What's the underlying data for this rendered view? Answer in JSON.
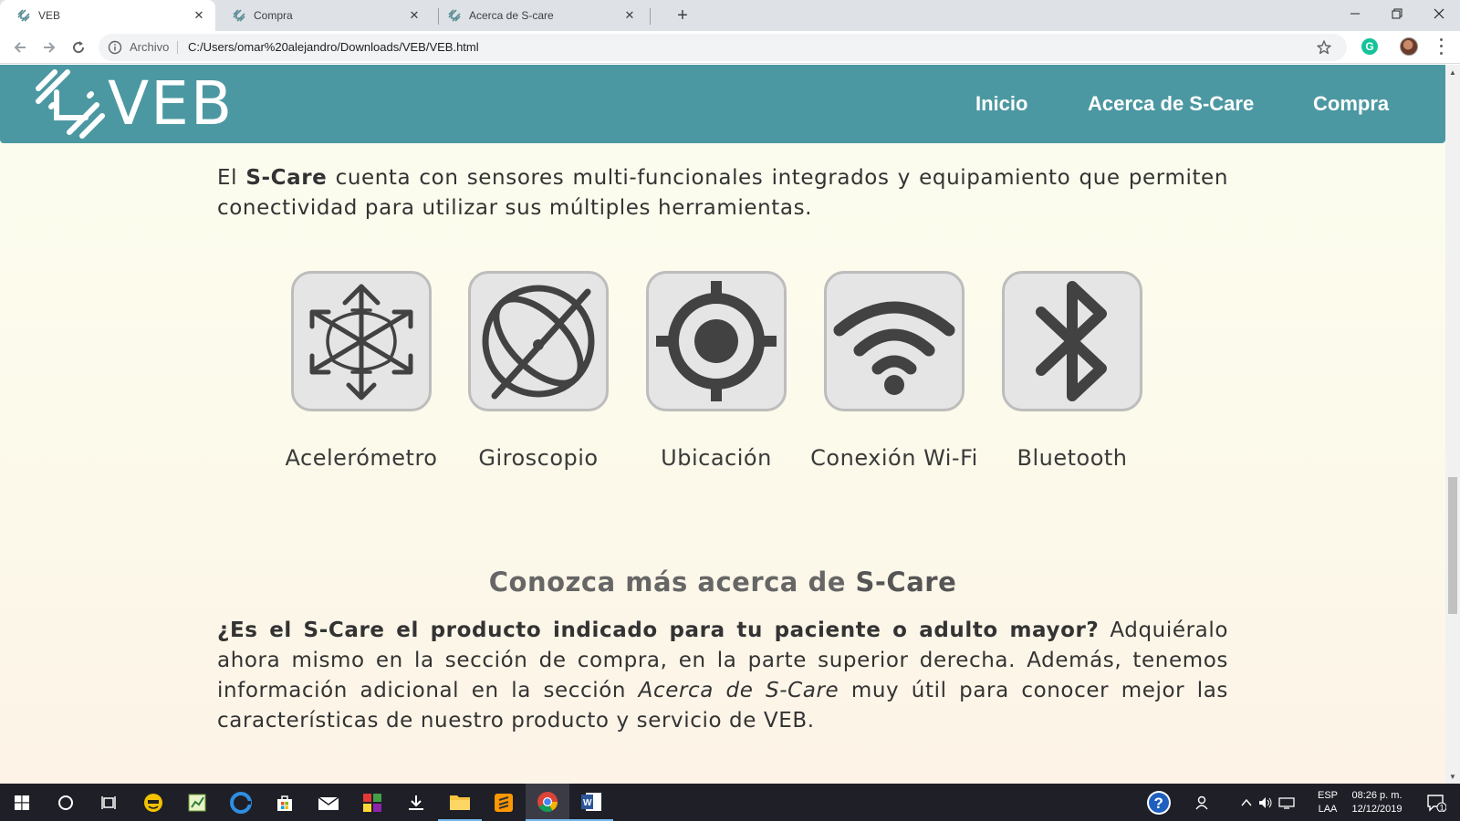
{
  "browser": {
    "tabs": [
      {
        "title": "VEB",
        "active": true
      },
      {
        "title": "Compra",
        "active": false
      },
      {
        "title": "Acerca de S-care",
        "active": false
      }
    ],
    "address": {
      "scheme_label": "Archivo",
      "url": "C:/Users/omar%20alejandro/Downloads/VEB/VEB.html"
    },
    "extension_icon": "G"
  },
  "site": {
    "logo_text": "VEB",
    "nav": [
      {
        "label": "Inicio"
      },
      {
        "label": "Acerca de S-Care"
      },
      {
        "label": "Compra"
      }
    ],
    "intro": {
      "prefix": "El ",
      "brand": "S-Care",
      "rest": " cuenta con sensores multi-funcionales integrados y equipamiento que permiten conectividad para utilizar sus múltiples herramientas."
    },
    "features": [
      {
        "label": "Acelerómetro",
        "icon": "accelerometer-icon"
      },
      {
        "label": "Giroscopio",
        "icon": "gyroscope-icon"
      },
      {
        "label": "Ubicación",
        "icon": "location-icon"
      },
      {
        "label": "Conexión Wi-Fi",
        "icon": "wifi-icon"
      },
      {
        "label": "Bluetooth",
        "icon": "bluetooth-icon"
      }
    ],
    "section": {
      "title_prefix": "Conozca más acerca de ",
      "title_brand": "S-Care",
      "question": "¿Es el S-Care el producto indicado para tu paciente o adulto mayor?",
      "text_1": " Adquiéralo ahora mismo en la sección de compra, en la parte superior derecha. Además, tenemos información adicional en la sección ",
      "link_italic": "Acerca de S-Care",
      "text_2": " muy útil para conocer mejor las características de nuestro producto y servicio de VEB."
    },
    "colors": {
      "header": "#4c98a2",
      "background": "#fcf9ea",
      "tile": "#e5e5e5",
      "icon": "#424242"
    }
  },
  "taskbar": {
    "language": "ESP",
    "layout": "LAA",
    "time": "08:26 p. m.",
    "date": "12/12/2019",
    "notifications": "1"
  }
}
